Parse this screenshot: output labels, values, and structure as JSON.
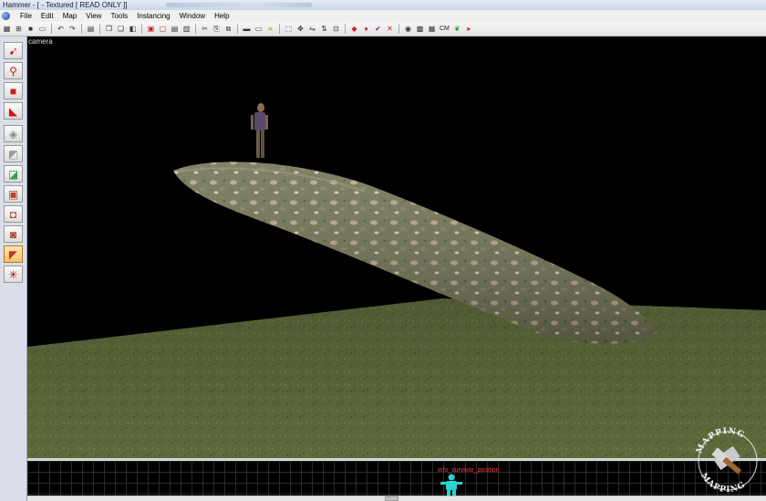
{
  "window": {
    "title": "Hammer - [ - Textured [ READ ONLY ]]"
  },
  "menu": {
    "items": [
      "File",
      "Edit",
      "Map",
      "View",
      "Tools",
      "Instancing",
      "Window",
      "Help"
    ]
  },
  "toolbar": {
    "cm_label": "CM"
  },
  "viewport": {
    "label": "camera"
  },
  "bottom_view": {
    "entity_label": "info_survivor_position"
  },
  "watermark": {
    "text_top": "MAPPING",
    "text_bottom": "MAPPING"
  },
  "colors": {
    "ground": "#5f6a3c",
    "rock": "#7a7d5a",
    "entity_label": "#ff3a3a",
    "entity_figure": "#27d3d3"
  }
}
